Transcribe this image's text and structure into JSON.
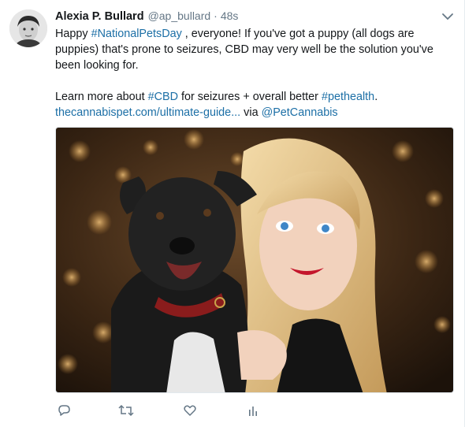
{
  "tweet": {
    "author_name": "Alexia P. Bullard",
    "author_handle": "@ap_bullard",
    "separator": "·",
    "timestamp": "48s",
    "line1_prefix": "Happy ",
    "hashtag_national_pets_day": "#NationalPetsDay",
    "line1_suffix": " , everyone! If you've got a puppy  (all dogs are puppies) that's prone to seizures, CBD may very well be the solution you've been looking for.",
    "line2_prefix": "Learn more about ",
    "hashtag_cbd": "#CBD",
    "line2_middle": " for seizures + overall better ",
    "hashtag_pethealth": "#pethealth",
    "line2_suffix": ".",
    "link_text": "thecannabispet.com/ultimate-guide...",
    "via_text": " via ",
    "mention": "@PetCannabis"
  },
  "icons": {
    "avatar": "avatar-photo",
    "caret": "chevron-down-icon",
    "media": "photo-dog-and-woman",
    "reply": "reply-icon",
    "retweet": "retweet-icon",
    "like": "heart-icon",
    "analytics": "analytics-icon"
  },
  "colors": {
    "link": "#1c6fa6",
    "secondary_text": "#657786",
    "icon": "#657786"
  }
}
